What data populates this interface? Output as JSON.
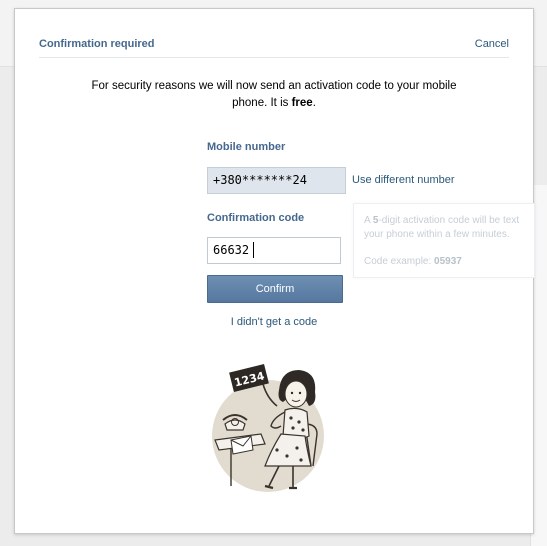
{
  "dialog": {
    "title": "Confirmation required",
    "cancel_label": "Cancel",
    "intro_before": "For security reasons we will now send an activation code to your mobile phone. It is ",
    "intro_bold": "free",
    "intro_after": "."
  },
  "mobile": {
    "label": "Mobile number",
    "value": "+380*******24",
    "use_different_label": "Use different number"
  },
  "code": {
    "label": "Confirmation code",
    "value": "66632"
  },
  "hint": {
    "line1_before": "A ",
    "line1_bold": "5",
    "line1_after": "-digit activation code will be text",
    "line2": "your phone within a few minutes.",
    "line3_label": "Code example: ",
    "line3_example": "05937"
  },
  "actions": {
    "confirm_label": "Confirm",
    "no_code_label": "I didn't get a code"
  },
  "illustration": {
    "sign_text": "1234"
  },
  "colors": {
    "accent": "#45688e",
    "link": "#2b587a",
    "button": "#5f81a8"
  }
}
